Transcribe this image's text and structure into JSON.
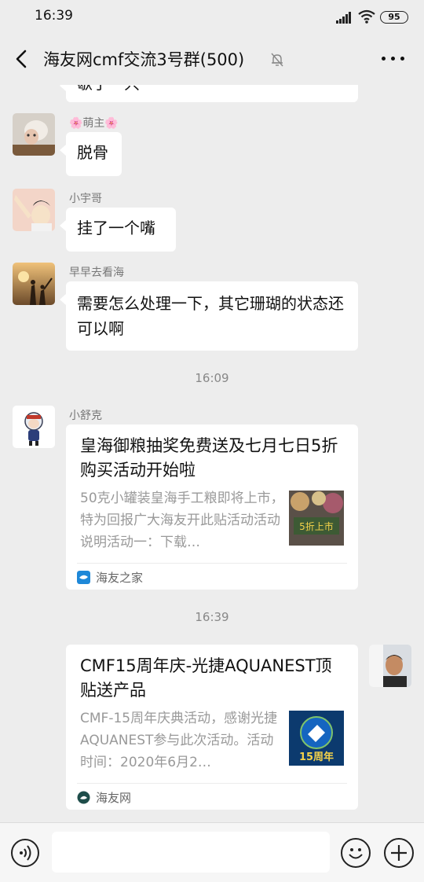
{
  "status_bar": {
    "time": "16:39",
    "battery": "95"
  },
  "header": {
    "title": "海友网cmf交流3号群(500)"
  },
  "messages": [
    {
      "sender": "",
      "text": "歇了一只"
    },
    {
      "sender": "🌸萌主🌸",
      "text": "脱骨"
    },
    {
      "sender": "小宇哥",
      "text": "挂了一个嘴"
    },
    {
      "sender": "早早去看海",
      "text": "需要怎么处理一下，其它珊瑚的状态还可以啊"
    }
  ],
  "timestamps": [
    "16:09",
    "16:39"
  ],
  "cards": [
    {
      "sender": "小舒克",
      "title": "皇海御粮抽奖免费送及七月七日5折购买活动开始啦",
      "desc": "50克小罐装皇海手工粮即将上市，特为回报广大海友开此贴活动活动说明活动一：下载…",
      "thumb_text": "5折上市",
      "source": "海友之家"
    },
    {
      "title": "CMF15周年庆-光捷AQUANEST顶贴送产品",
      "desc": "CMF-15周年庆典活动，感谢光捷AQUANEST参与此次活动。活动时间：2020年6月2…",
      "thumb_text": "15周年",
      "source": "海友网"
    }
  ],
  "input": {
    "placeholder": ""
  }
}
